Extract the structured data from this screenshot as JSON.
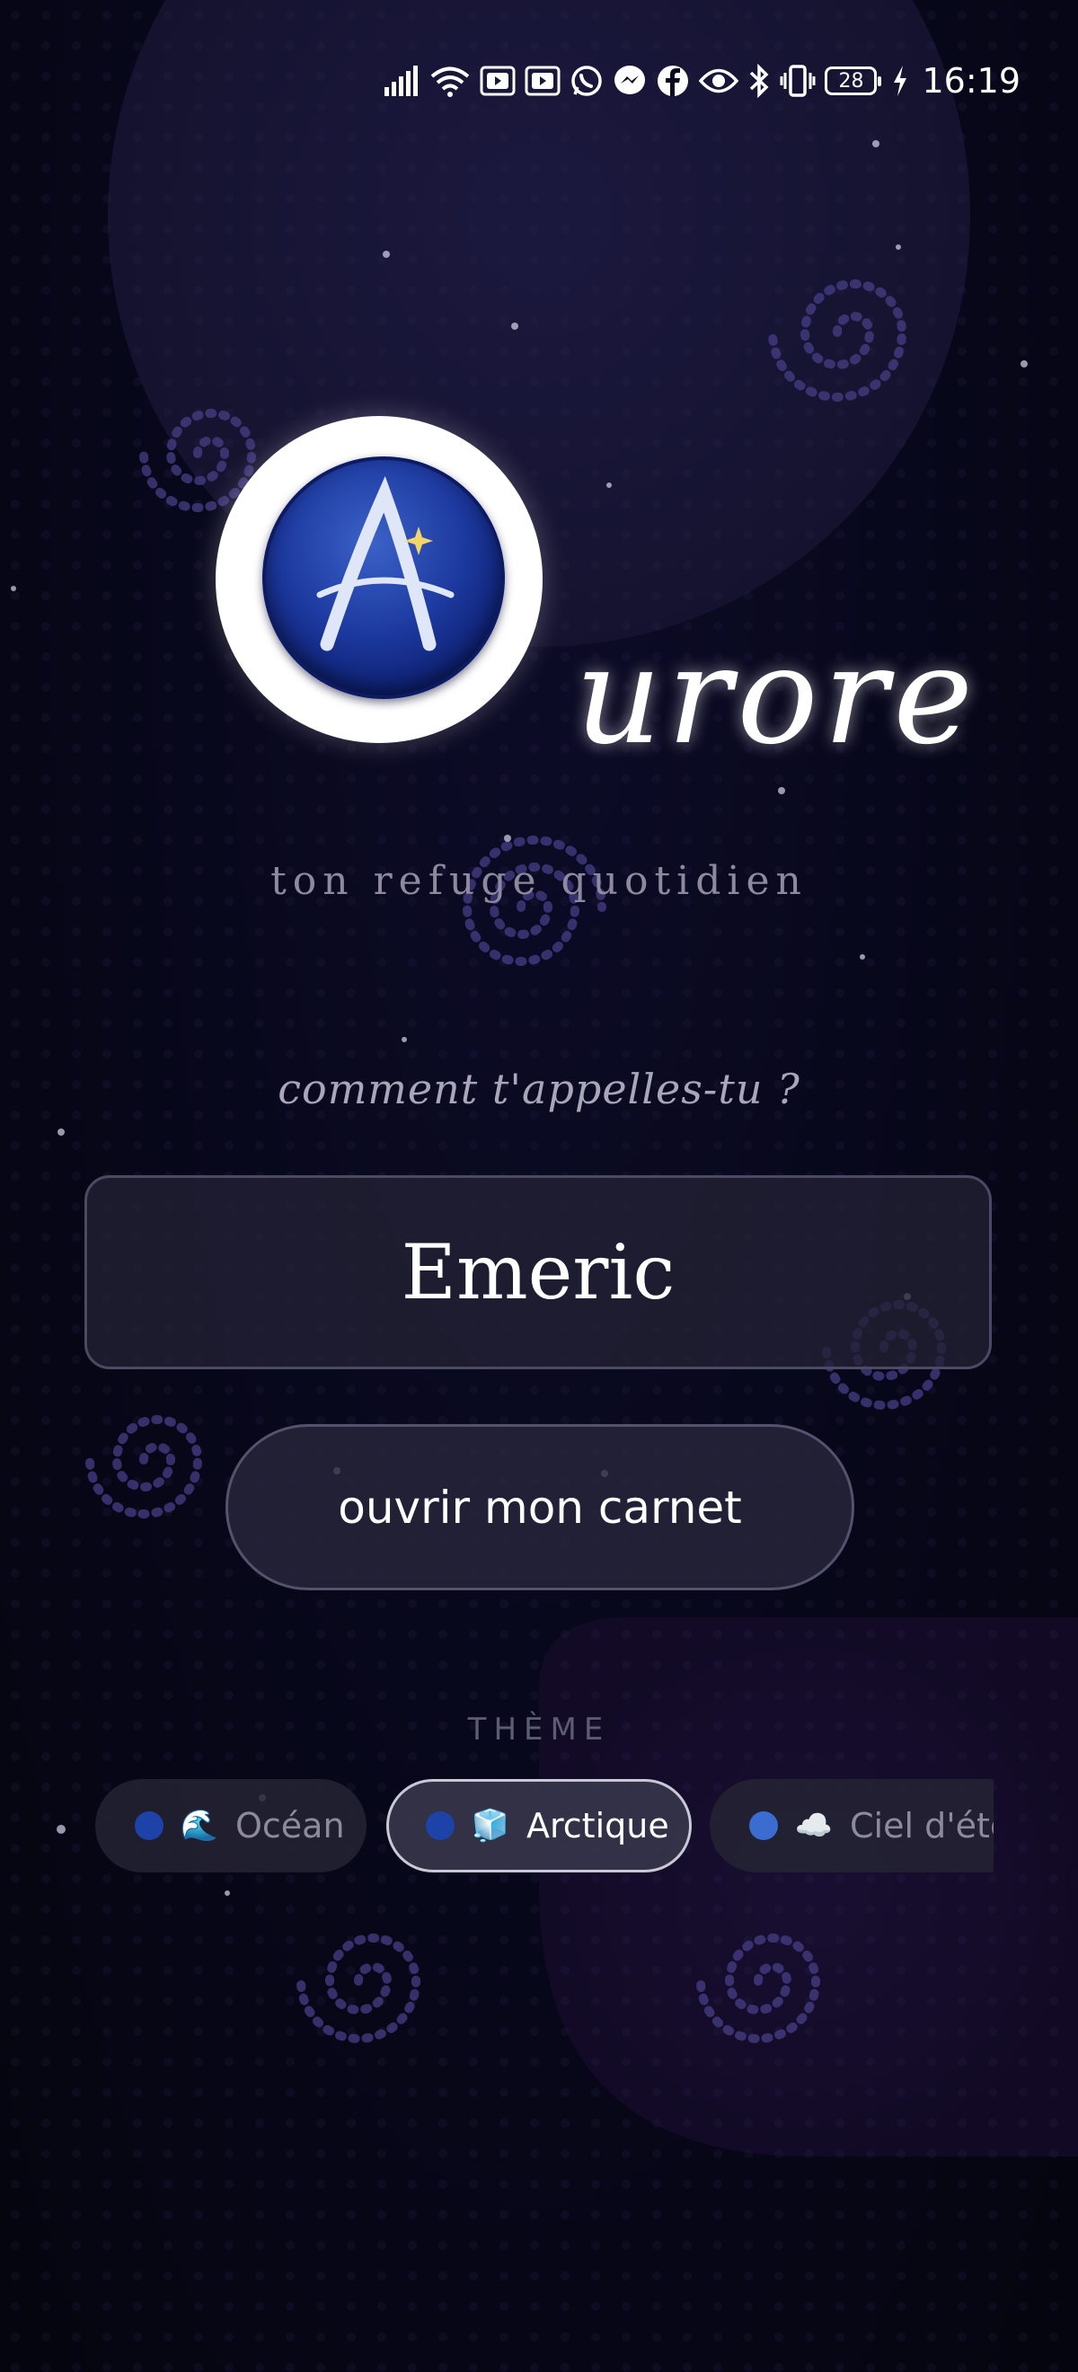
{
  "status_bar": {
    "time": "16:19",
    "battery_level": "28",
    "icons": [
      "signal-icon",
      "wifi-icon",
      "youtube-icon",
      "youtube-icon",
      "whatsapp-icon",
      "messenger-icon",
      "facebook-icon",
      "eye-icon",
      "bluetooth-icon",
      "vibrate-icon",
      "battery-icon",
      "charging-icon"
    ]
  },
  "app": {
    "logo_letter": "A",
    "wordmark": "urore",
    "tagline": "ton refuge quotidien"
  },
  "login": {
    "prompt": "comment t'appelles-tu ?",
    "name_value": "Emeric",
    "open_button_label": "ouvrir mon carnet"
  },
  "theme": {
    "heading": "THÈME",
    "selected": "Arctique",
    "options": [
      {
        "label": "Océan",
        "icon": "wave-emoji",
        "glyph": "🌊"
      },
      {
        "label": "Arctique",
        "icon": "ice-cube-emoji",
        "glyph": "🧊"
      },
      {
        "label": "Ciel d'été",
        "icon": "cloud-emoji",
        "glyph": "☁️"
      }
    ]
  },
  "colors": {
    "background": "#07071a",
    "accent_blue": "#1d43a8",
    "text_muted": "#8d8a9f"
  }
}
